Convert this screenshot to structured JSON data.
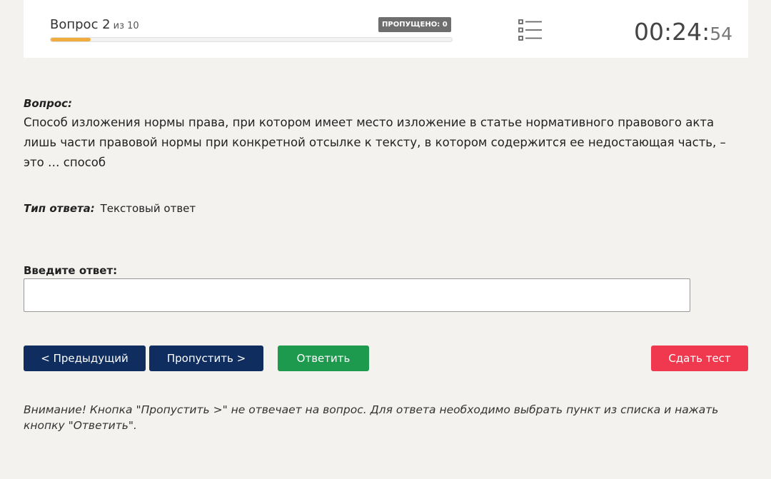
{
  "header": {
    "question_label": "Вопрос 2",
    "question_of": "из 10",
    "skipped_badge": "ПРОПУЩЕНО: 0",
    "progress": 0.1,
    "timer_main": "00:24:",
    "timer_seconds": "54",
    "list_icon": "list-icon"
  },
  "question": {
    "label": "Вопрос:",
    "text": "Способ изложения нормы права, при котором имеет место изложение в статье нормативного правового акта лишь части правовой нормы при конкретной отсылке к тексту, в котором содержится ее недостающая часть, – это … способ"
  },
  "answer_type": {
    "label": "Тип ответа:",
    "value": "Текстовый ответ"
  },
  "answer_input": {
    "label": "Введите ответ:",
    "value": "",
    "placeholder": ""
  },
  "buttons": {
    "prev": "< Предыдущий",
    "skip": "Пропустить >",
    "answer": "Ответить",
    "submit": "Сдать тест"
  },
  "colors": {
    "nav_button": "#0f2d5e",
    "answer_button": "#1e9a4e",
    "submit_button": "#f0394f",
    "progress": "#f0ad3e"
  },
  "notice": "Внимание! Кнопка \"Пропустить >\" не отвечает на вопрос. Для ответа необходимо выбрать пункт из списка и нажать кнопку \"Ответить\"."
}
